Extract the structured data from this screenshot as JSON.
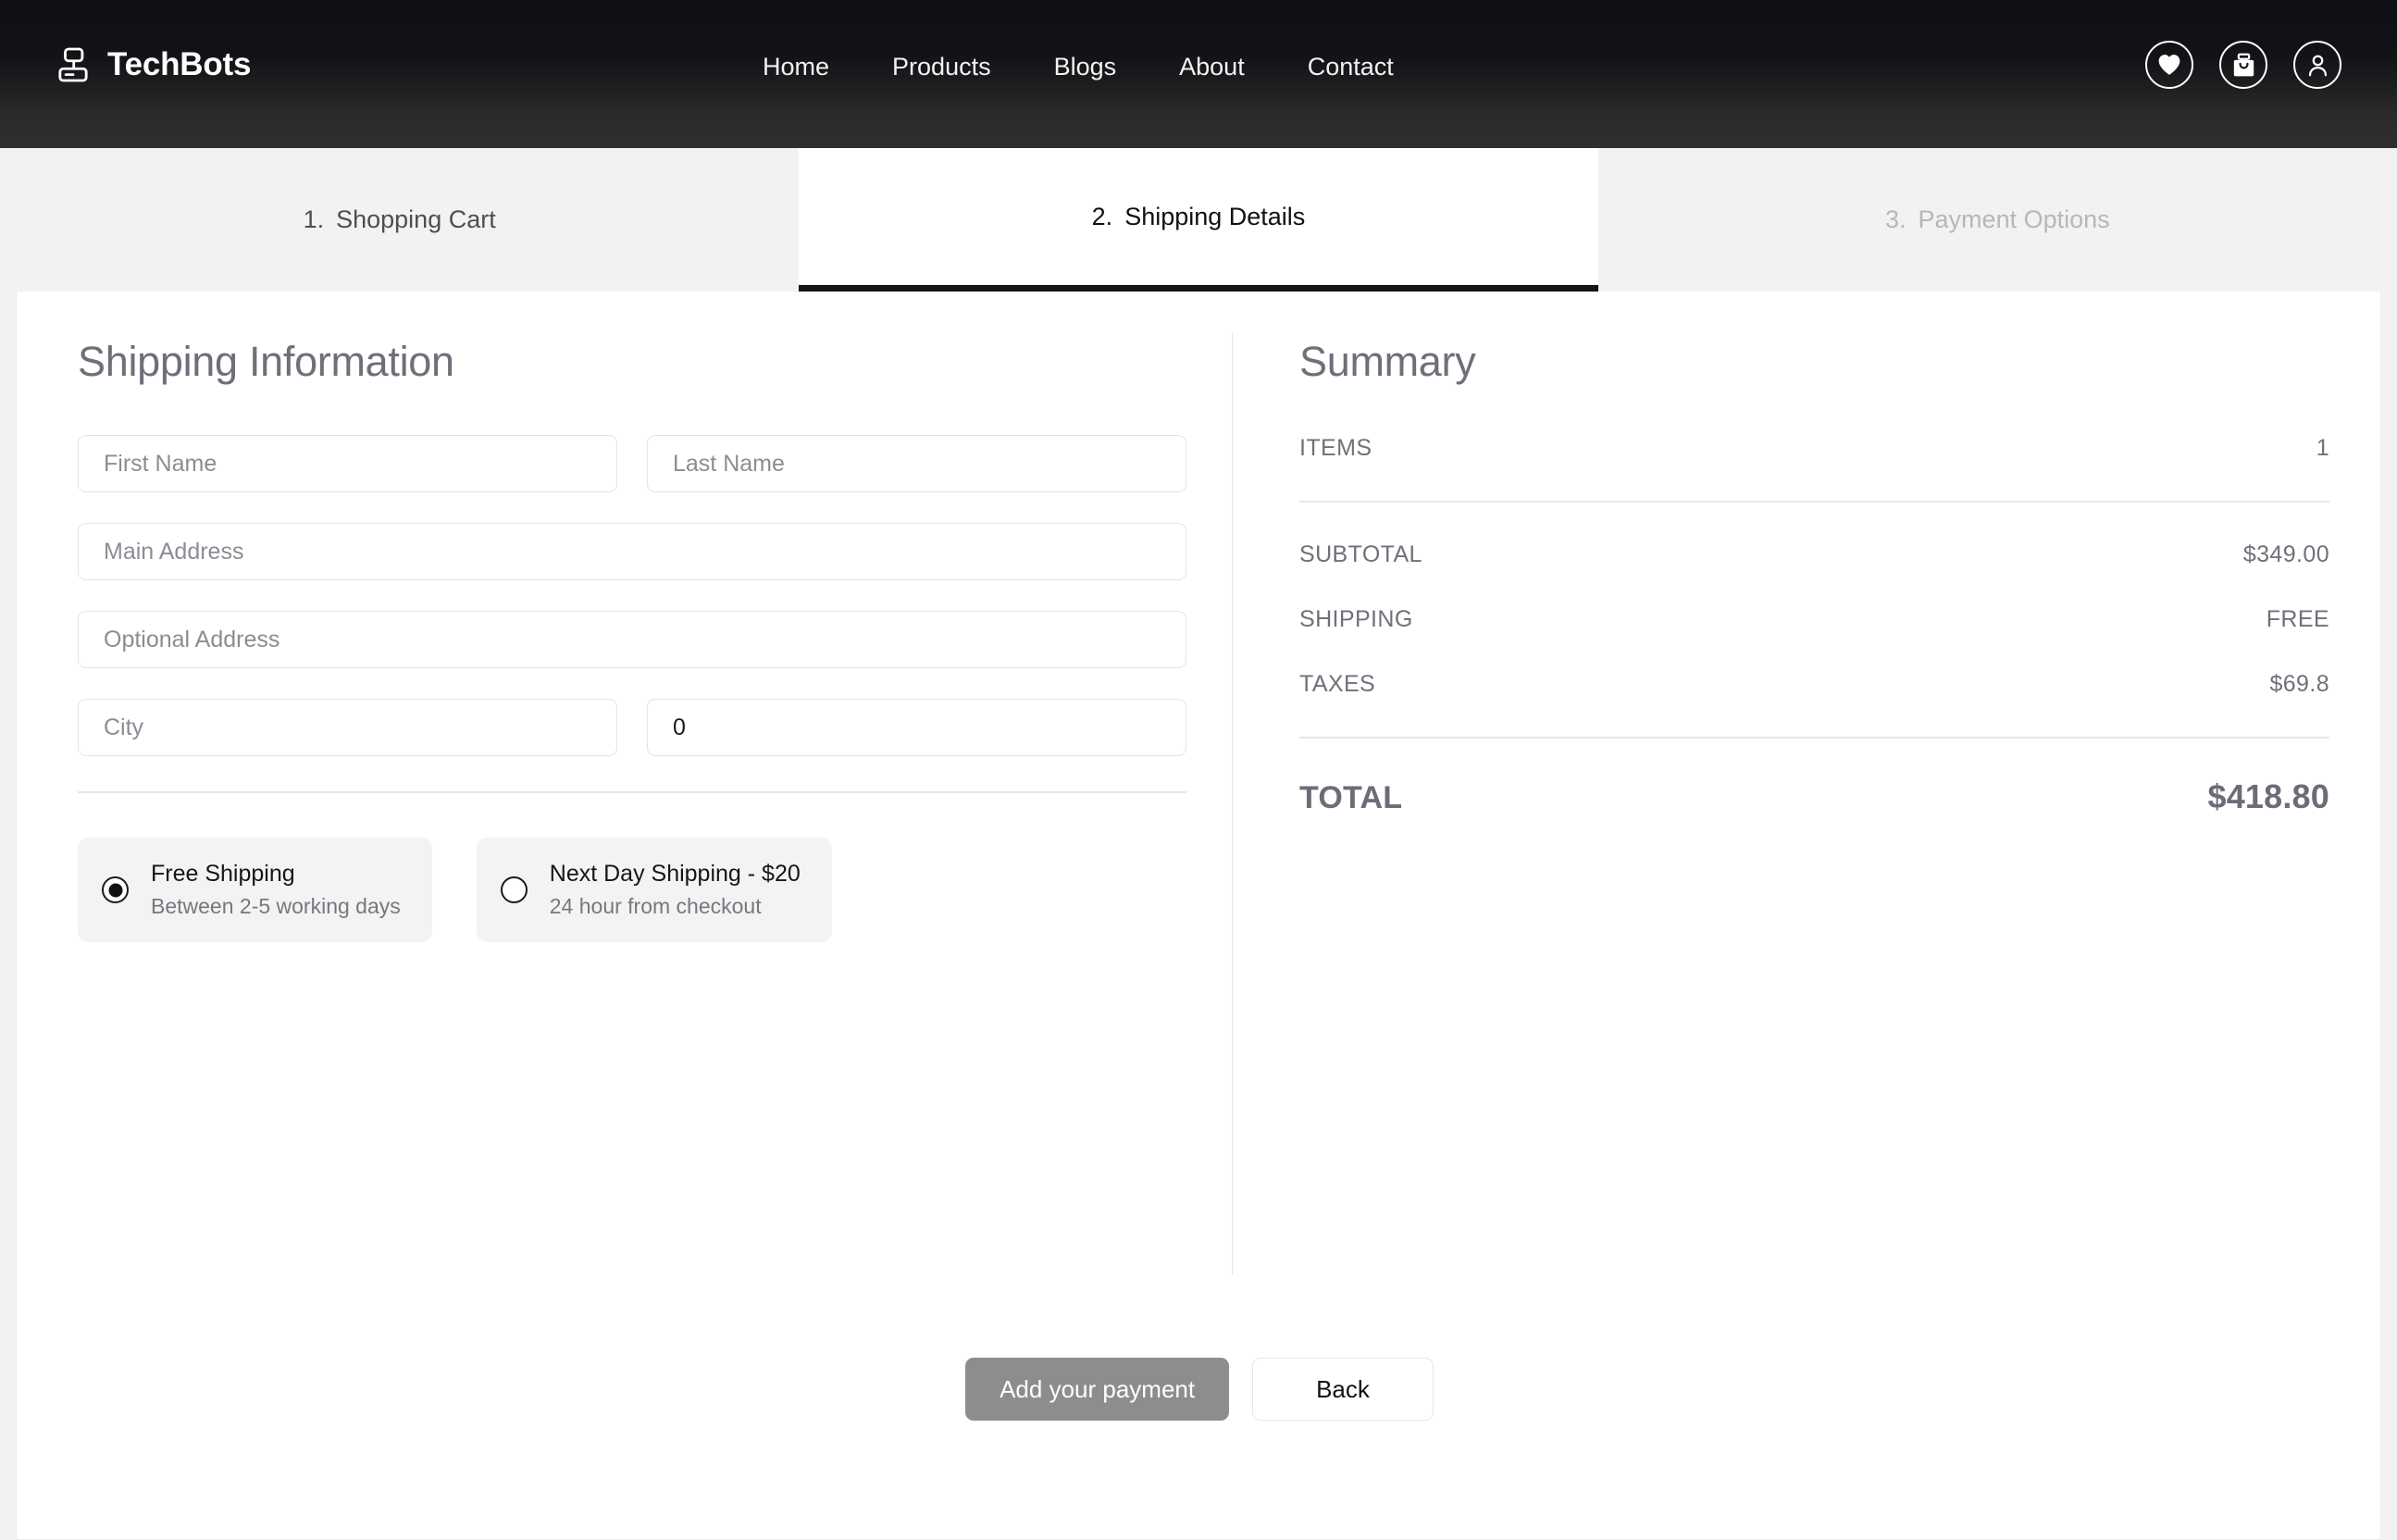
{
  "header": {
    "brand": "TechBots",
    "logo_icon": "computer-icon",
    "nav": [
      {
        "label": "Home"
      },
      {
        "label": "Products"
      },
      {
        "label": "Blogs"
      },
      {
        "label": "About"
      },
      {
        "label": "Contact"
      }
    ],
    "actions": [
      {
        "icon": "heart-icon",
        "name": "wishlist-button"
      },
      {
        "icon": "shopping-bag-icon",
        "name": "cart-button"
      },
      {
        "icon": "user-icon",
        "name": "account-button"
      }
    ]
  },
  "steps": [
    {
      "num": "1.",
      "label": "Shopping Cart",
      "state": "completed"
    },
    {
      "num": "2.",
      "label": "Shipping Details",
      "state": "active"
    },
    {
      "num": "3.",
      "label": "Payment Options",
      "state": "upcoming"
    }
  ],
  "shipping": {
    "title": "Shipping Information",
    "fields": {
      "first_name": {
        "placeholder": "First Name",
        "value": ""
      },
      "last_name": {
        "placeholder": "Last Name",
        "value": ""
      },
      "main_address": {
        "placeholder": "Main Address",
        "value": ""
      },
      "optional_address": {
        "placeholder": "Optional Address",
        "value": ""
      },
      "city": {
        "placeholder": "City",
        "value": ""
      },
      "zip": {
        "placeholder": "",
        "value": "0"
      }
    },
    "options": [
      {
        "title": "Free Shipping",
        "subtitle": "Between 2-5 working days",
        "selected": true
      },
      {
        "title": "Next Day Shipping - $20",
        "subtitle": "24 hour from checkout",
        "selected": false
      }
    ]
  },
  "summary": {
    "title": "Summary",
    "items_label": "ITEMS",
    "items_value": "1",
    "subtotal_label": "SUBTOTAL",
    "subtotal_value": "$349.00",
    "shipping_label": "SHIPPING",
    "shipping_value": "FREE",
    "taxes_label": "TAXES",
    "taxes_value": "$69.8",
    "total_label": "TOTAL",
    "total_value": "$418.80"
  },
  "actions": {
    "primary": "Add your payment",
    "secondary": "Back"
  },
  "colors": {
    "header_dark": "#0e0f13",
    "header_light": "#2e2e30",
    "accent_text": "#6d7079",
    "primary_button": "#8d8d8f",
    "active_tab_border": "#131313"
  }
}
